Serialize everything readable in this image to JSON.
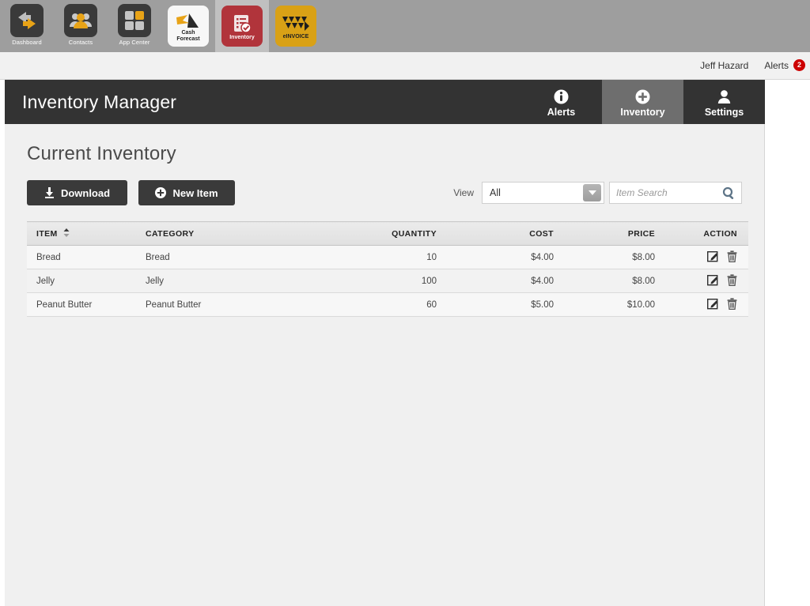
{
  "app_bar": {
    "tiles": [
      {
        "label": "Dashboard",
        "icon": "dashboard-icon",
        "style": "dark",
        "inner_text": "",
        "active": false
      },
      {
        "label": "Contacts",
        "icon": "contacts-icon",
        "style": "dark",
        "inner_text": "",
        "active": false
      },
      {
        "label": "App Center",
        "icon": "app-center-icon",
        "style": "dark",
        "inner_text": "",
        "active": false
      },
      {
        "label": "",
        "icon": "cash-forecast-icon",
        "style": "white",
        "inner_text": "Cash\nForecast",
        "active": false
      },
      {
        "label": "",
        "icon": "inventory-icon",
        "style": "red",
        "inner_text": "Inventory",
        "active": true
      },
      {
        "label": "",
        "icon": "einvoice-icon",
        "style": "gold",
        "inner_text": "eINVOICE",
        "active": false
      }
    ]
  },
  "account_bar": {
    "user_name": "Jeff Hazard",
    "alerts_label": "Alerts",
    "alerts_count": "2",
    "badge_color": "#cc0000"
  },
  "module": {
    "title": "Inventory Manager",
    "nav": [
      {
        "label": "Alerts",
        "icon": "info-icon",
        "active": false
      },
      {
        "label": "Inventory",
        "icon": "plus-circle-icon",
        "active": true
      },
      {
        "label": "Settings",
        "icon": "person-icon",
        "active": false
      }
    ]
  },
  "content": {
    "page_title": "Current Inventory",
    "download_label": "Download",
    "new_item_label": "New Item",
    "view_label": "View",
    "view_selected": "All",
    "view_options": [
      "All"
    ],
    "search_placeholder": "Item Search",
    "search_value": ""
  },
  "table": {
    "columns": [
      "ITEM",
      "CATEGORY",
      "QUANTITY",
      "COST",
      "PRICE",
      "ACTION"
    ],
    "sort_column": "ITEM",
    "rows": [
      {
        "item": "Bread",
        "category": "Bread",
        "quantity": "10",
        "cost": "$4.00",
        "price": "$8.00"
      },
      {
        "item": "Jelly",
        "category": "Jelly",
        "quantity": "100",
        "cost": "$4.00",
        "price": "$8.00"
      },
      {
        "item": "Peanut Butter",
        "category": "Peanut Butter",
        "quantity": "60",
        "cost": "$5.00",
        "price": "$10.00"
      }
    ],
    "row_actions": [
      "edit-icon",
      "delete-icon"
    ]
  },
  "colors": {
    "app_bar_bg": "#9e9e9e",
    "module_header_bg": "#333333",
    "active_tab_bg": "#6e6e6e",
    "panel_bg": "#f0f0f0",
    "button_bg": "#3a3a3a",
    "brand_gold": "#d9a116",
    "brand_red": "#b1343b"
  }
}
